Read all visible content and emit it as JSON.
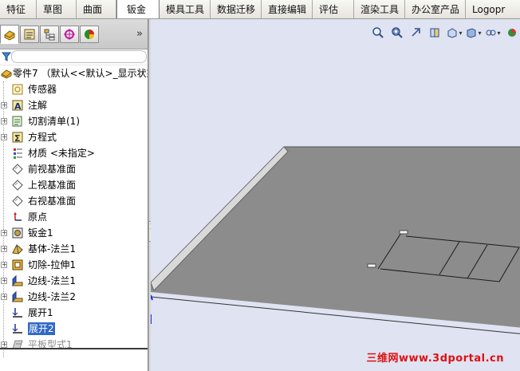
{
  "command_tabs": [
    "特征",
    "草图",
    "曲面",
    "钣金",
    "模具工具",
    "数据迁移",
    "直接编辑",
    "评估",
    "渲染工具",
    "办公室产品",
    "Logopr"
  ],
  "active_tab_index": 3,
  "panel": {
    "tab_icons": [
      "feature-manager-icon",
      "property-manager-icon",
      "configuration-manager-icon",
      "dimxpert-icon",
      "display-manager-icon"
    ],
    "more_label": "»",
    "filter_placeholder": ""
  },
  "tree": {
    "root_label": "零件7 （默认<<默认>_显示状态",
    "items": [
      {
        "label": "传感器",
        "icon": "sensor-icon",
        "expandable": false
      },
      {
        "label": "注解",
        "icon": "annotations-icon",
        "expandable": true
      },
      {
        "label": "切割清单(1)",
        "icon": "cut-list-icon",
        "expandable": true
      },
      {
        "label": "方程式",
        "icon": "equations-icon",
        "expandable": true
      },
      {
        "label": "材质 <未指定>",
        "icon": "material-icon",
        "expandable": false
      },
      {
        "label": "前视基准面",
        "icon": "plane-icon",
        "expandable": false
      },
      {
        "label": "上视基准面",
        "icon": "plane-icon",
        "expandable": false
      },
      {
        "label": "右视基准面",
        "icon": "plane-icon",
        "expandable": false
      },
      {
        "label": "原点",
        "icon": "origin-icon",
        "expandable": false
      },
      {
        "label": "钣金1",
        "icon": "sheet-metal-icon",
        "expandable": true
      },
      {
        "label": "基体-法兰1",
        "icon": "base-flange-icon",
        "expandable": true
      },
      {
        "label": "切除-拉伸1",
        "icon": "cut-extrude-icon",
        "expandable": true
      },
      {
        "label": "边线-法兰1",
        "icon": "edge-flange-icon",
        "expandable": true
      },
      {
        "label": "边线-法兰2",
        "icon": "edge-flange-icon",
        "expandable": true
      },
      {
        "label": "展开1",
        "icon": "unfold-icon",
        "expandable": false
      },
      {
        "label": "展开2",
        "icon": "unfold-icon",
        "expandable": false,
        "selected": true
      },
      {
        "label": "平板型式1",
        "icon": "flat-pattern-icon",
        "expandable": true,
        "suppressed": true
      }
    ]
  },
  "view_toolbar": [
    "zoom-to-fit-icon",
    "zoom-to-area-icon",
    "previous-view-icon",
    "section-view-icon",
    "view-orientation-icon",
    "display-style-icon",
    "hide-show-items-icon",
    "edit-appearance-icon"
  ],
  "watermark": "三维网www.3dportal.cn",
  "colors": {
    "selection": "#3169c6",
    "viewport_bg": "#dfe3f2",
    "part_face": "#8c8c8c"
  }
}
